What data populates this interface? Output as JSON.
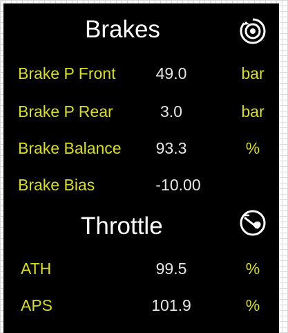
{
  "brakes": {
    "title": "Brakes",
    "icon": "brake-disc-icon",
    "rows": [
      {
        "label": "Brake P Front",
        "value": "49.0",
        "unit": "bar"
      },
      {
        "label": "Brake P Rear",
        "value": "3.0",
        "unit": "bar"
      },
      {
        "label": "Brake Balance",
        "value": "93.3",
        "unit": "%"
      },
      {
        "label": "Brake Bias",
        "value": "-10.00",
        "unit": ""
      }
    ]
  },
  "throttle": {
    "title": "Throttle",
    "icon": "throttle-pedal-icon",
    "rows": [
      {
        "label": "ATH",
        "value": "99.5",
        "unit": "%"
      },
      {
        "label": "APS",
        "value": "101.9",
        "unit": "%"
      }
    ]
  },
  "colors": {
    "background": "#000000",
    "label": "#d9df1b",
    "value": "#e6e6e6",
    "title": "#ffffff"
  }
}
